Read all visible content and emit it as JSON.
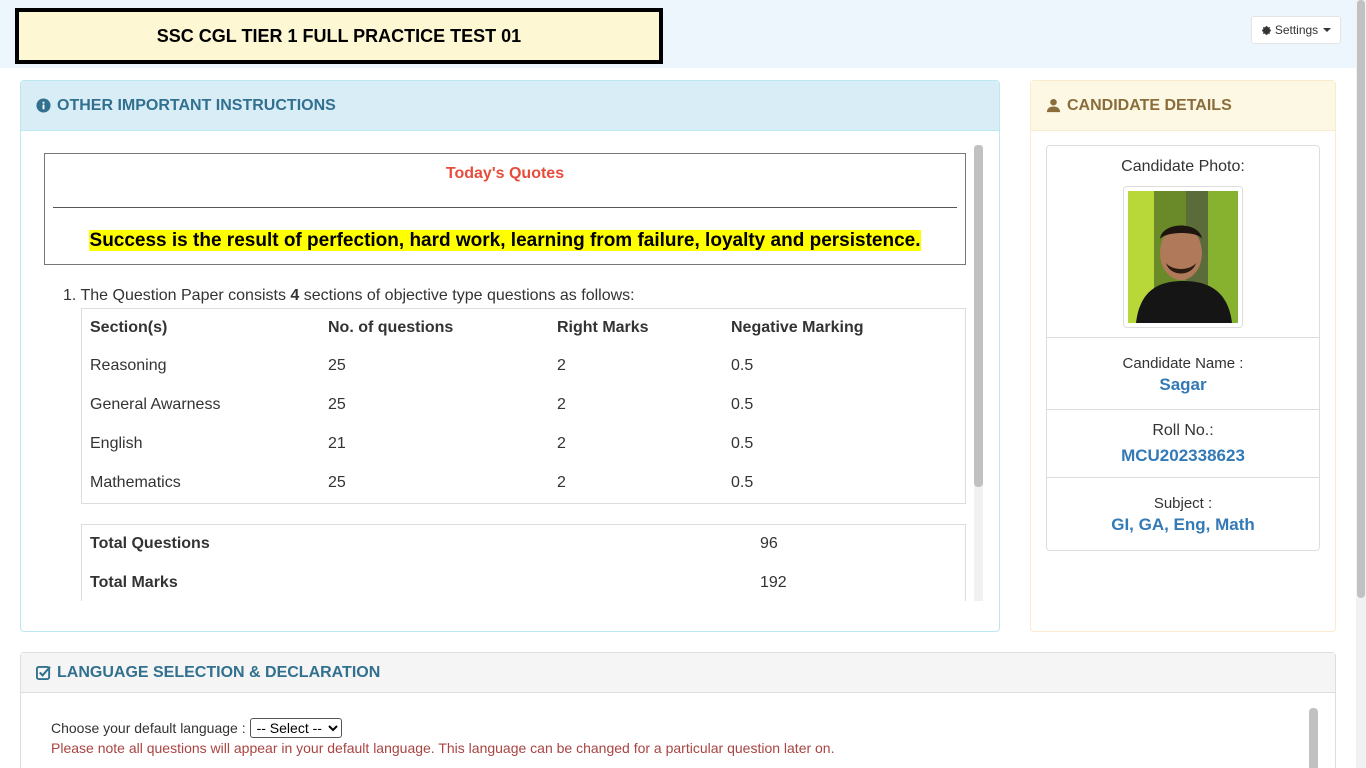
{
  "header": {
    "title": "SSC CGL TIER 1 FULL PRACTICE TEST 01",
    "settings_label": "Settings"
  },
  "instructions": {
    "heading": "OTHER IMPORTANT INSTRUCTIONS",
    "quote_title": "Today's Quotes",
    "quote": "Success is the result of perfection, hard work, learning from failure, loyalty and persistence.",
    "item1_num": "1.",
    "item1_pre": "The Question Paper consists",
    "item1_count": "4",
    "item1_post": "sections of objective type questions as follows:",
    "table_headers": [
      "Section(s)",
      "No. of questions",
      "Right Marks",
      "Negative Marking"
    ],
    "rows": [
      [
        "Reasoning",
        "25",
        "2",
        "0.5"
      ],
      [
        "General Awarness",
        "25",
        "2",
        "0.5"
      ],
      [
        "English",
        "21",
        "2",
        "0.5"
      ],
      [
        "Mathematics",
        "25",
        "2",
        "0.5"
      ]
    ],
    "totals": [
      [
        "Total Questions",
        "96"
      ],
      [
        "Total Marks",
        "192"
      ]
    ]
  },
  "candidate": {
    "heading": "CANDIDATE DETAILS",
    "photo_label": "Candidate Photo:",
    "name_label": "Candidate Name :",
    "name": "Sagar",
    "roll_label": "Roll No.:",
    "roll": "MCU202338623",
    "subject_label": "Subject :",
    "subject": "GI, GA, Eng, Math"
  },
  "language": {
    "heading": "LANGUAGE SELECTION & DECLARATION",
    "choose_label": "Choose your default language :",
    "select_value": "-- Select --",
    "note": "Please note all questions will appear in your default language. This language can be changed for a particular question later on."
  },
  "colors": {
    "info_text": "#31708f",
    "warning_text": "#8a6d3b",
    "link_blue": "#337ab7",
    "quote_red": "#e74c3c",
    "danger_text": "#a94442",
    "highlight": "#ffff00"
  },
  "icons": {
    "settings": "gear-icon",
    "instructions": "info-circle-icon",
    "candidate": "user-icon",
    "language": "check-square-icon"
  }
}
